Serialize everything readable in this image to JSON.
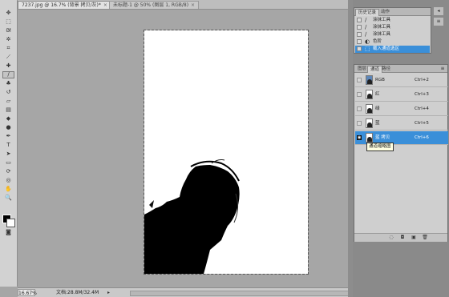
{
  "toolbox": {
    "tools": [
      {
        "name": "move-tool",
        "glyph": "✥"
      },
      {
        "name": "marquee-tool",
        "glyph": "⬚"
      },
      {
        "name": "lasso-tool",
        "glyph": "ᘛ"
      },
      {
        "name": "magic-wand-tool",
        "glyph": "✲"
      },
      {
        "name": "crop-tool",
        "glyph": "⌗"
      },
      {
        "name": "eyedropper-tool",
        "glyph": "⟋"
      },
      {
        "name": "healing-brush-tool",
        "glyph": "✚"
      },
      {
        "name": "brush-tool",
        "glyph": "∕"
      },
      {
        "name": "clone-stamp-tool",
        "glyph": "♣"
      },
      {
        "name": "history-brush-tool",
        "glyph": "↺"
      },
      {
        "name": "eraser-tool",
        "glyph": "▱"
      },
      {
        "name": "gradient-tool",
        "glyph": "▤"
      },
      {
        "name": "blur-tool",
        "glyph": "◆"
      },
      {
        "name": "dodge-tool",
        "glyph": "●"
      },
      {
        "name": "pen-tool",
        "glyph": "✒"
      },
      {
        "name": "type-tool",
        "glyph": "T"
      },
      {
        "name": "path-selection-tool",
        "glyph": "➤"
      },
      {
        "name": "shape-tool",
        "glyph": "▭"
      },
      {
        "name": "3d-rotate-tool",
        "glyph": "⟳"
      },
      {
        "name": "3d-orbit-tool",
        "glyph": "◎"
      },
      {
        "name": "hand-tool",
        "glyph": "✋"
      },
      {
        "name": "zoom-tool",
        "glyph": "🔍"
      }
    ],
    "active_index": 7
  },
  "tabs": [
    {
      "label": "7237.jpg @ 16.7% (背景 拷贝/灰)*",
      "close": "×"
    },
    {
      "label": "未标题-1 @ 50% (图层 1, RGB/8)",
      "close": "×"
    }
  ],
  "status": {
    "zoom": "16.67%",
    "docsize": "文档:28.8M/32.4M"
  },
  "history": {
    "tabs": [
      "历史记录",
      "动作"
    ],
    "items": [
      {
        "icon": "∕",
        "label": "涂抹工具"
      },
      {
        "icon": "∕",
        "label": "涂抹工具"
      },
      {
        "icon": "∕",
        "label": "涂抹工具"
      },
      {
        "icon": "◐",
        "label": "色阶"
      },
      {
        "icon": "⬚",
        "label": "载入通道选区"
      }
    ]
  },
  "channels": {
    "tabs": [
      "图层",
      "通道",
      "路径"
    ],
    "rows": [
      {
        "name": "RGB",
        "shortcut": "Ctrl+2"
      },
      {
        "name": "红",
        "shortcut": "Ctrl+3"
      },
      {
        "name": "绿",
        "shortcut": "Ctrl+4"
      },
      {
        "name": "蓝",
        "shortcut": "Ctrl+5"
      },
      {
        "name": "蓝 拷贝",
        "shortcut": "Ctrl+6"
      }
    ],
    "tooltip": "通道缩略图"
  },
  "colors": {
    "accent": "#3a8fd9",
    "canvas_bg": "#a6a6a6"
  }
}
